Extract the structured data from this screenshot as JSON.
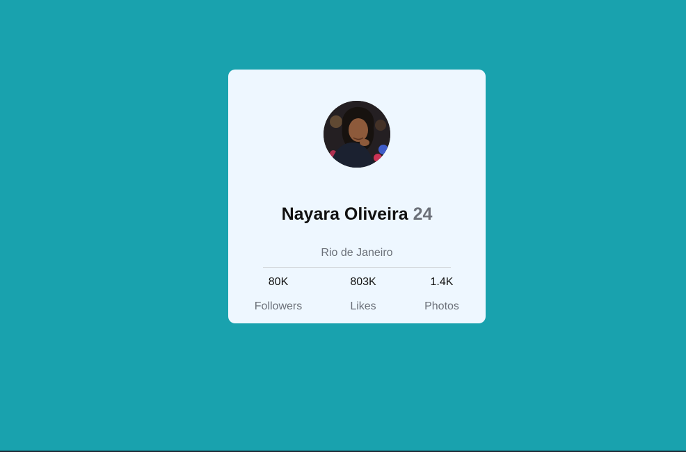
{
  "colors": {
    "background": "#19a2ae",
    "card": "#eef7ff",
    "name": "#111111",
    "muted": "#6b7079"
  },
  "profile": {
    "avatar_icon": "profile-photo",
    "name": "Nayara Oliveira",
    "age": "24",
    "location": "Rio de Janeiro"
  },
  "stats": [
    {
      "value": "80K",
      "label": "Followers"
    },
    {
      "value": "803K",
      "label": "Likes"
    },
    {
      "value": "1.4K",
      "label": "Photos"
    }
  ]
}
